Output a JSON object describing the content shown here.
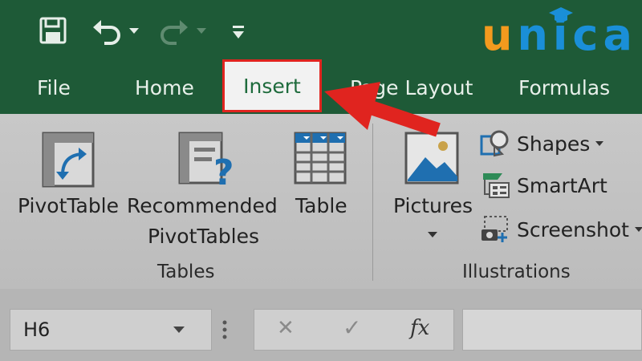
{
  "brand": {
    "letters": [
      "u",
      "n",
      "i",
      "c",
      "a"
    ]
  },
  "tabs": {
    "file": "File",
    "home": "Home",
    "insert": "Insert",
    "page_layout": "Page Layout",
    "formulas": "Formulas"
  },
  "ribbon": {
    "pivot_table": "PivotTable",
    "recommended_line1": "Recommended",
    "recommended_line2": "PivotTables",
    "table": "Table",
    "tables_group": "Tables",
    "pictures": "Pictures",
    "shapes": "Shapes",
    "smartart": "SmartArt",
    "screenshot": "Screenshot",
    "illustrations_group": "Illustrations"
  },
  "formula_bar": {
    "name_box_value": "H6",
    "cancel_glyph": "✕",
    "enter_glyph": "✓",
    "fx_label": "fx"
  },
  "colors": {
    "title_green": "#1e5a37",
    "highlight_red": "#e0241f",
    "brand_orange": "#f39a1e",
    "brand_blue": "#1a8fd8"
  }
}
